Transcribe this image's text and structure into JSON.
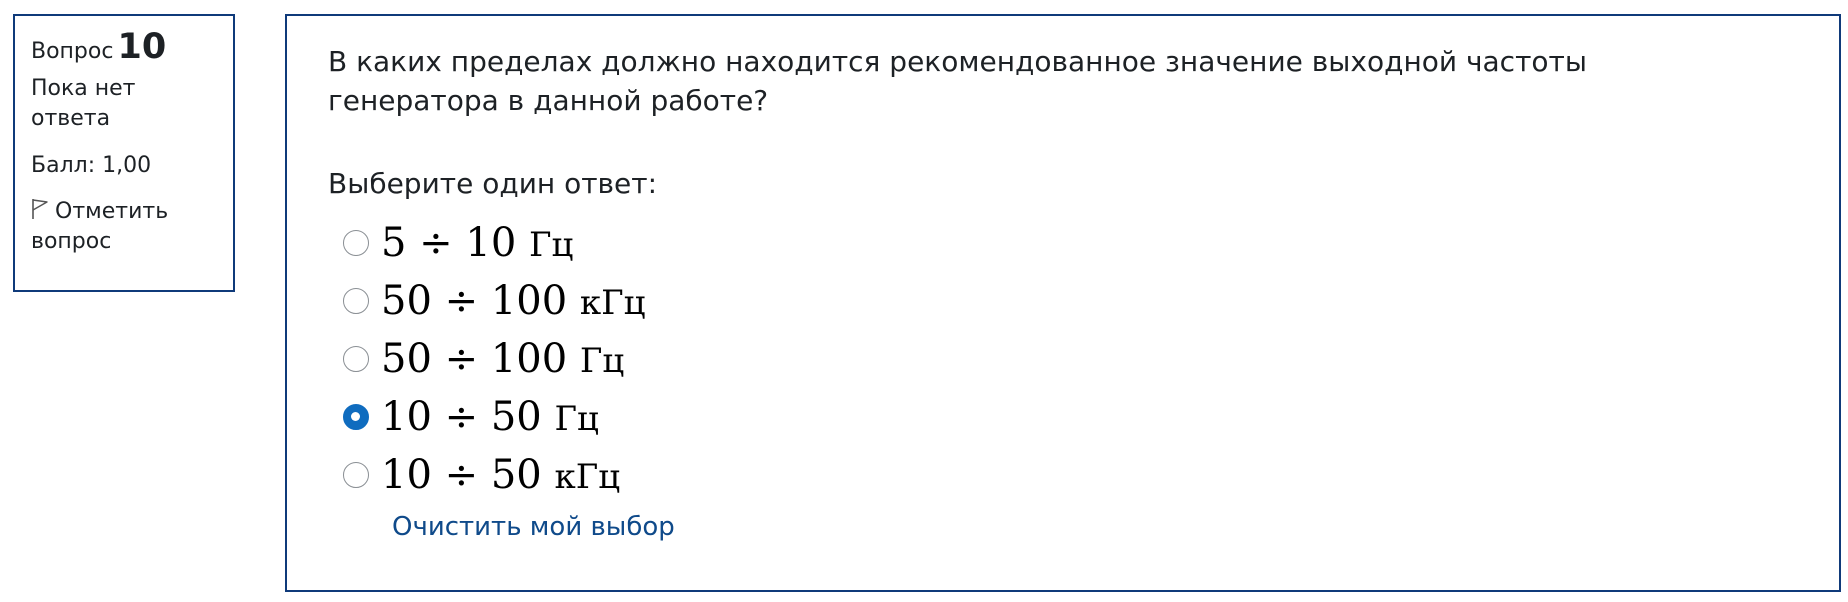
{
  "info": {
    "question_label": "Вопрос",
    "question_number": "10",
    "state": "Пока нет ответа",
    "grade": "Балл: 1,00",
    "flag_label": "Отметить вопрос",
    "flag_icon": "flag-outline-icon"
  },
  "question": {
    "text": "В каких пределах должно находится рекомендованное значение выходной частоты генератора в данной работе?",
    "prompt": "Выберите один ответ:",
    "options": [
      {
        "value": "5 ÷ 10",
        "unit": "Гц",
        "selected": false
      },
      {
        "value": "50 ÷ 100",
        "unit": "кГц",
        "selected": false
      },
      {
        "value": "50 ÷ 100",
        "unit": "Гц",
        "selected": false
      },
      {
        "value": "10 ÷ 50",
        "unit": "Гц",
        "selected": true
      },
      {
        "value": "10 ÷ 50",
        "unit": "кГц",
        "selected": false
      }
    ],
    "clear_label": "Очистить мой выбор"
  },
  "colors": {
    "border": "#0f3a7a",
    "radio_selected": "#0f6cbf",
    "link": "#0f4a8a"
  }
}
